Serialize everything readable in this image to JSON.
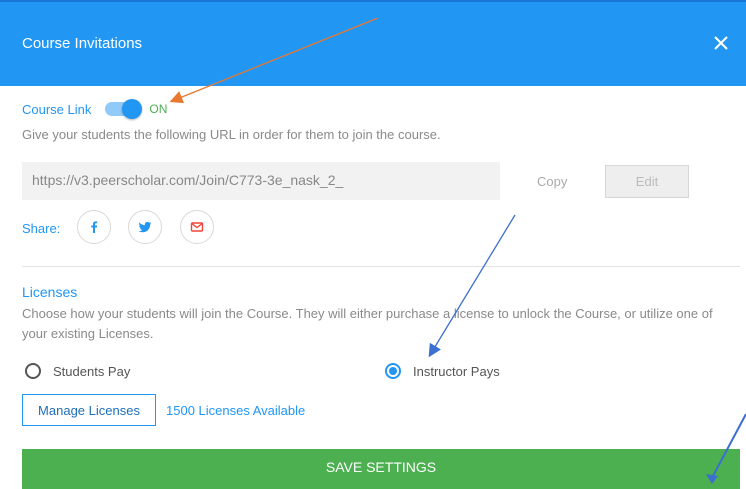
{
  "header": {
    "title": "Course Invitations",
    "close_icon": "close-icon"
  },
  "course_link": {
    "label": "Course Link",
    "toggle_state": "ON",
    "toggle_on": true,
    "description": "Give your students the following URL in order for them to join the course.",
    "url": "https://v3.peerscholar.com/Join/C773-3e_nask_2_",
    "copy_label": "Copy",
    "edit_label": "Edit"
  },
  "share": {
    "label": "Share:",
    "icons": [
      "facebook-icon",
      "twitter-icon",
      "email-icon"
    ]
  },
  "licenses": {
    "title": "Licenses",
    "description_line1": "Choose how your students will join the Course. They will either purchase a license to unlock the Course, or utilize one of",
    "description_line2": "your existing Licenses.",
    "options": [
      {
        "label": "Students Pay",
        "selected": false
      },
      {
        "label": "Instructor Pays",
        "selected": true
      }
    ],
    "manage_label": "Manage Licenses",
    "available_text": "1500 Licenses Available"
  },
  "footer": {
    "save_label": "SAVE SETTINGS"
  },
  "colors": {
    "header_bg": "#2196f3",
    "accent": "#2196f3",
    "on_green": "#4caf50",
    "save_green": "#4caf50",
    "annotation_orange": "#e8782f",
    "annotation_blue": "#3b6fd0"
  }
}
